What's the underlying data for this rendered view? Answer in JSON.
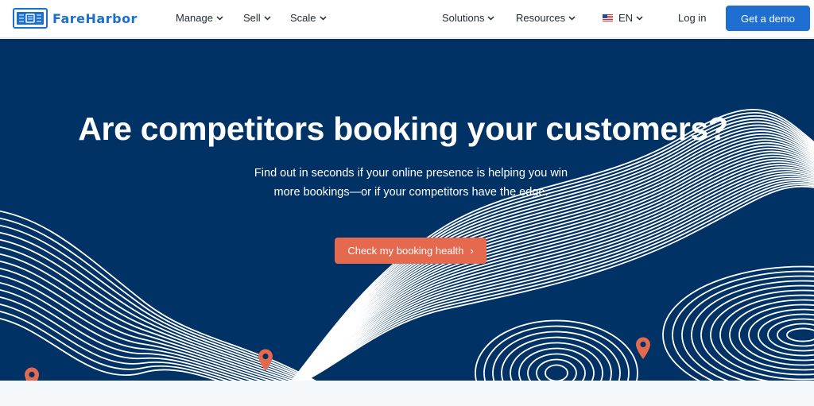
{
  "brand": {
    "name": "FareHarbor",
    "logo_icon": "fareharbor-ticket-icon",
    "color": "#1a6fcf"
  },
  "nav": {
    "left": [
      {
        "label": "Manage",
        "icon": "chevron-down-icon"
      },
      {
        "label": "Sell",
        "icon": "chevron-down-icon"
      },
      {
        "label": "Scale",
        "icon": "chevron-down-icon"
      }
    ],
    "right": [
      {
        "label": "Solutions",
        "icon": "chevron-down-icon"
      },
      {
        "label": "Resources",
        "icon": "chevron-down-icon"
      }
    ],
    "language": {
      "label": "EN",
      "flag_icon": "us-flag-icon"
    },
    "login_label": "Log in",
    "demo_label": "Get a demo"
  },
  "hero": {
    "title": "Are competitors booking your customers?",
    "subtitle_line1": "Find out in seconds if your online presence is helping you win",
    "subtitle_line2": "more bookings—or if your competitors have the edge.",
    "cta_label": "Check my booking health",
    "cta_arrow": "›",
    "background_color": "#013265",
    "cta_color": "#e5694e",
    "pin_icon": "map-pin-icon"
  },
  "colors": {
    "demo_button": "#1f6fd2",
    "contour_lines": "#ffffff"
  }
}
